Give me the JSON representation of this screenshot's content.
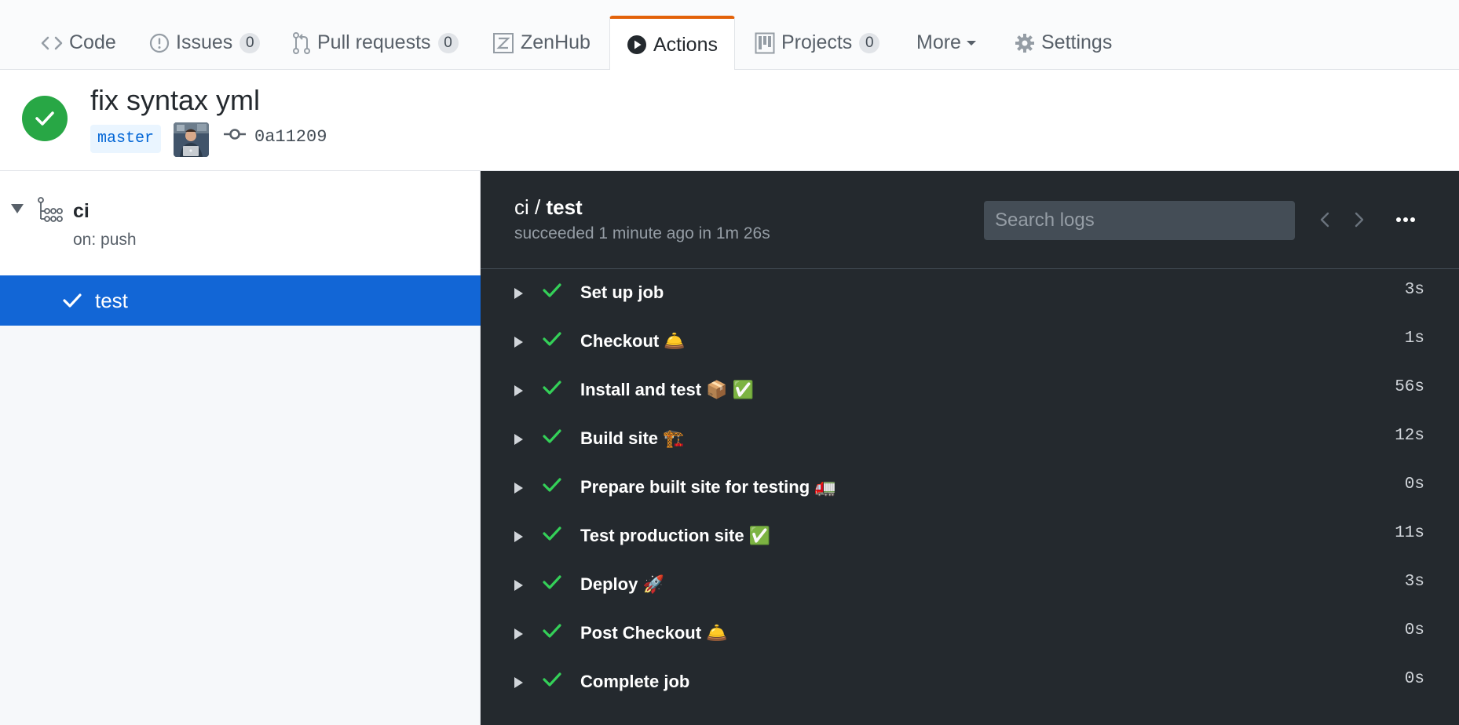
{
  "nav": {
    "tabs": [
      {
        "label": "Code",
        "icon": "code-icon"
      },
      {
        "label": "Issues",
        "icon": "issue-icon",
        "count": "0"
      },
      {
        "label": "Pull requests",
        "icon": "pull-request-icon",
        "count": "0"
      },
      {
        "label": "ZenHub",
        "icon": "zenhub-icon"
      },
      {
        "label": "Actions",
        "icon": "play-icon",
        "selected": true
      },
      {
        "label": "Projects",
        "icon": "project-icon",
        "count": "0"
      },
      {
        "label": "More",
        "icon": "caret-down-icon"
      },
      {
        "label": "Settings",
        "icon": "gear-icon"
      }
    ]
  },
  "run": {
    "title": "fix syntax yml",
    "status": "success",
    "branch": "master",
    "commit_sha": "0a11209"
  },
  "workflow": {
    "name": "ci",
    "trigger": "on: push",
    "jobs": [
      {
        "name": "test",
        "status": "success",
        "selected": true
      }
    ]
  },
  "log": {
    "workflow_name": "ci",
    "separator": " / ",
    "job_name": "test",
    "status_text": "succeeded 1 minute ago in 1m 26s",
    "search_placeholder": "Search logs",
    "steps": [
      {
        "name": "Set up job",
        "duration": "3s"
      },
      {
        "name": "Checkout 🛎️",
        "duration": "1s"
      },
      {
        "name": "Install and test 📦 ✅",
        "duration": "56s"
      },
      {
        "name": "Build site 🏗️",
        "duration": "12s"
      },
      {
        "name": "Prepare built site for testing 🚛",
        "duration": "0s"
      },
      {
        "name": "Test production site ✅",
        "duration": "11s"
      },
      {
        "name": "Deploy 🚀",
        "duration": "3s"
      },
      {
        "name": "Post Checkout 🛎️",
        "duration": "0s"
      },
      {
        "name": "Complete job",
        "duration": "0s"
      }
    ]
  },
  "colors": {
    "accent_orange": "#e36209",
    "success_green": "#28a745",
    "selected_blue": "#1266d6",
    "log_bg": "#24292e"
  }
}
